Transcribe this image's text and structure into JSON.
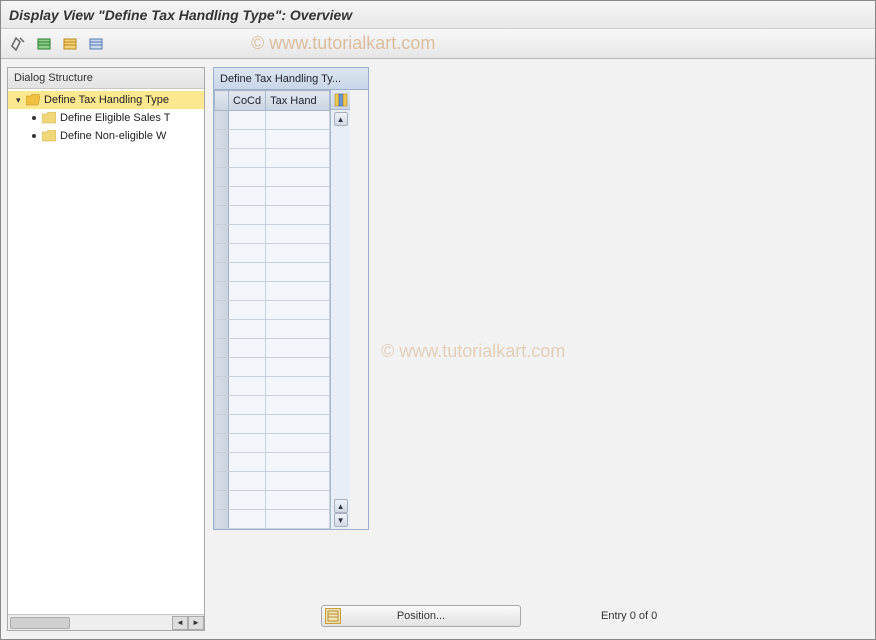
{
  "title": "Display View \"Define Tax Handling Type\": Overview",
  "watermark": "© www.tutorialkart.com",
  "toolbar": {
    "icons": [
      "wrench-icon",
      "table-green-icon",
      "table-orange-icon",
      "table-blue-icon"
    ]
  },
  "dialog": {
    "header": "Dialog Structure",
    "items": [
      {
        "label": "Define Tax Handling Type",
        "level": 0,
        "selected": true,
        "open": true
      },
      {
        "label": "Define Eligible Sales T",
        "level": 1,
        "selected": false,
        "open": false
      },
      {
        "label": "Define Non-eligible W",
        "level": 1,
        "selected": false,
        "open": false
      }
    ]
  },
  "table": {
    "title": "Define Tax Handling Ty...",
    "columns": [
      "CoCd",
      "Tax Hand"
    ],
    "row_count": 22
  },
  "footer": {
    "position_label": "Position...",
    "entry_text": "Entry 0 of 0"
  }
}
